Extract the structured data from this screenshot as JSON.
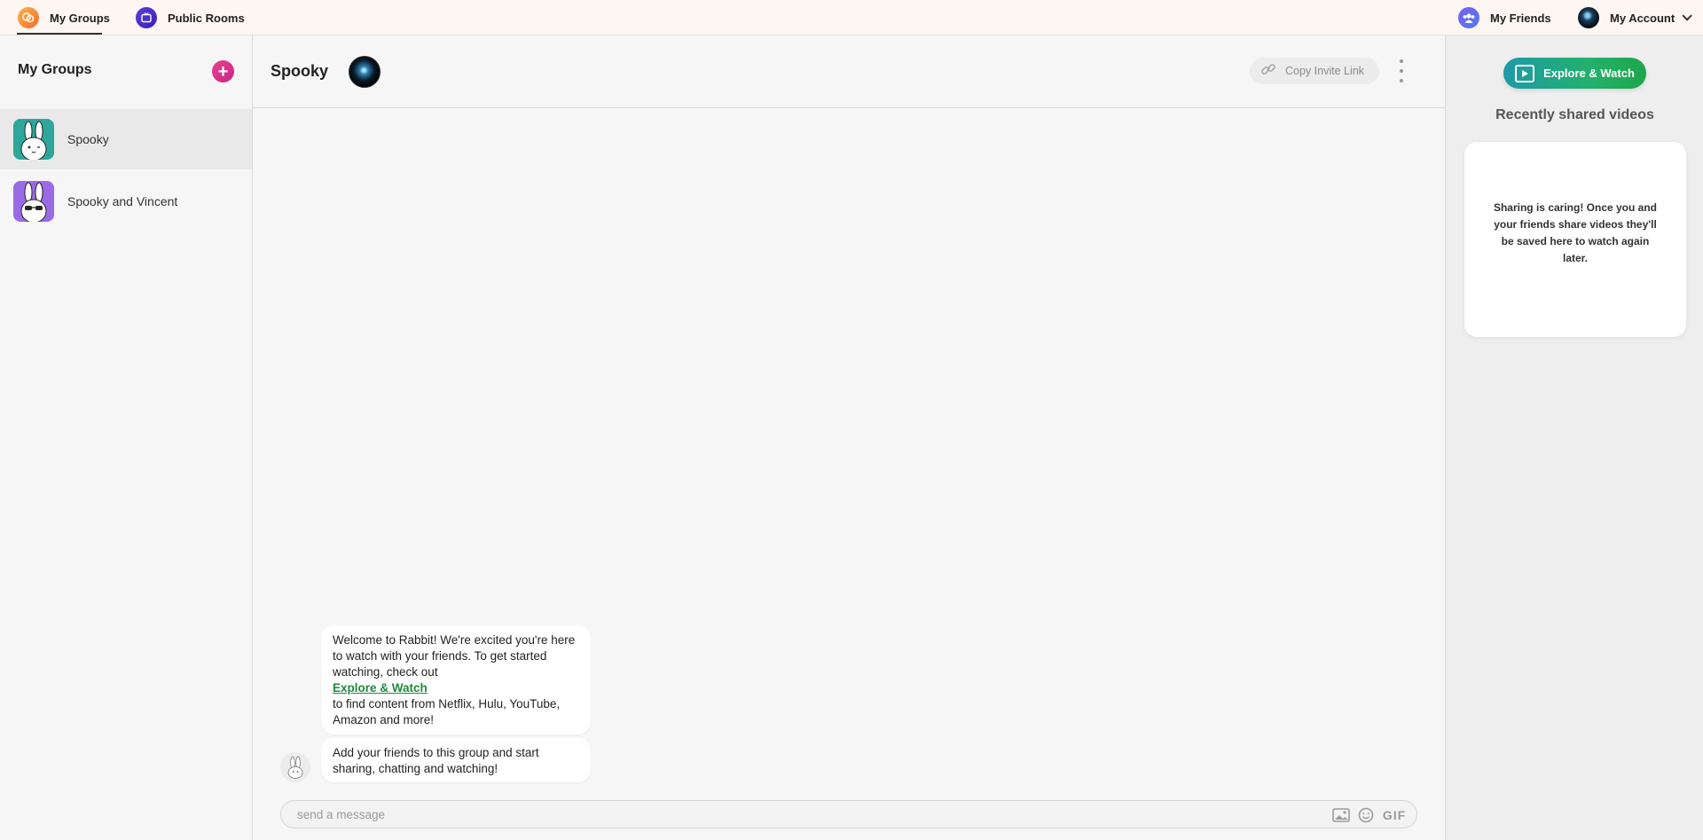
{
  "nav": {
    "my_groups": "My Groups",
    "public_rooms": "Public Rooms",
    "my_friends": "My Friends",
    "my_account": "My Account"
  },
  "sidebar": {
    "title": "My Groups",
    "add_label": "+",
    "groups": [
      {
        "name": "Spooky",
        "active": true
      },
      {
        "name": "Spooky and Vincent",
        "active": false
      }
    ]
  },
  "chat": {
    "title": "Spooky",
    "invite_label": "Copy Invite Link",
    "messages": {
      "welcome_intro": "Welcome to Rabbit! We're excited you're here to watch with your friends. To get started watching, check out",
      "welcome_link": "Explore & Watch",
      "welcome_outro": "to find content from Netflix, Hulu, YouTube, Amazon and more!",
      "add_friends": "Add your friends to this group and start sharing, chatting and watching!"
    },
    "composer_placeholder": "send a message",
    "gif_label": "GIF"
  },
  "right_panel": {
    "explore_label": "Explore & Watch",
    "title": "Recently shared videos",
    "empty_text": "Sharing is caring! Once you and your friends share videos they'll be saved here to watch again later."
  },
  "colors": {
    "accent_pink": "#e0338a",
    "explore_green": "#23b06d",
    "link_green": "#1e8a3c"
  }
}
